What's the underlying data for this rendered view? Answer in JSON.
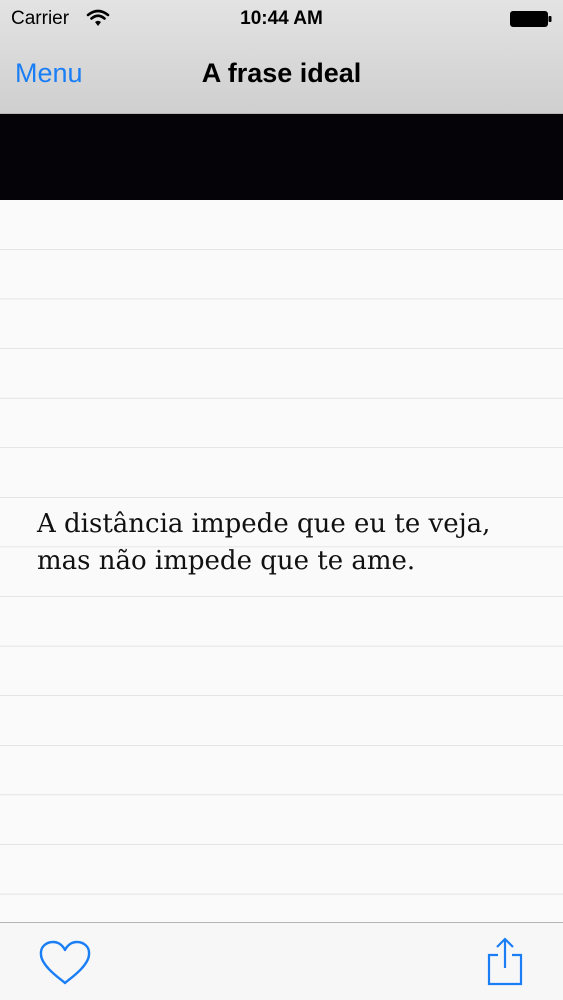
{
  "status_bar": {
    "carrier": "Carrier",
    "time": "10:44 AM",
    "wifi_icon": "wifi-icon",
    "battery_icon": "battery-icon"
  },
  "nav_bar": {
    "menu_label": "Menu",
    "title": "A frase ideal"
  },
  "content": {
    "quote": "A distância impede que eu te veja, mas não impede que te ame."
  },
  "toolbar": {
    "favorite_icon": "heart-icon",
    "share_icon": "share-icon"
  },
  "colors": {
    "accent": "#1a7ef5",
    "banner": "#050307",
    "paper_line": "#cfcfcf"
  }
}
